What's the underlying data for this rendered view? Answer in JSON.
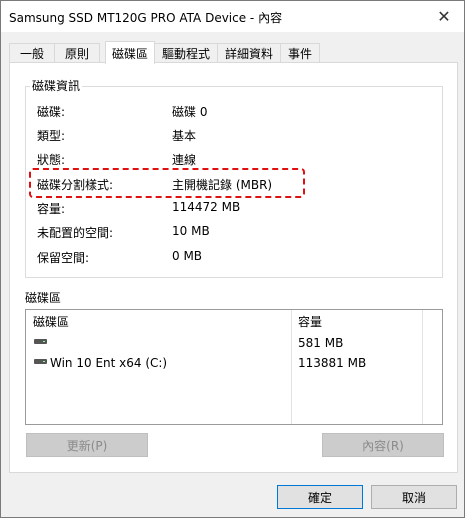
{
  "window": {
    "title": "Samsung SSD MT120G PRO ATA Device - 內容",
    "close_glyph": "✕"
  },
  "tabs": [
    {
      "label": "一般"
    },
    {
      "label": "原則"
    },
    {
      "label": "磁碟區"
    },
    {
      "label": "驅動程式"
    },
    {
      "label": "詳細資料"
    },
    {
      "label": "事件"
    }
  ],
  "active_tab": "磁碟區",
  "disk_info": {
    "group_label": "磁碟資訊",
    "rows": [
      {
        "label": "磁碟:",
        "value": "磁碟 0"
      },
      {
        "label": "類型:",
        "value": "基本"
      },
      {
        "label": "狀態:",
        "value": "連線"
      },
      {
        "label": "磁碟分割樣式:",
        "value": "主開機記錄 (MBR)"
      },
      {
        "label": "容量:",
        "value": "114472 MB"
      },
      {
        "label": "未配置的空間:",
        "value": "10 MB"
      },
      {
        "label": "保留空間:",
        "value": "0 MB"
      }
    ],
    "highlight_color": "#e01010"
  },
  "volumes": {
    "group_label": "磁碟區",
    "columns": [
      "磁碟區",
      "容量"
    ],
    "rows": [
      {
        "name": "",
        "capacity": "581 MB",
        "icon": "disk-icon"
      },
      {
        "name": "Win 10 Ent x64 (C:)",
        "capacity": "113881 MB",
        "icon": "disk-icon"
      }
    ]
  },
  "buttons": {
    "refresh": "更新(P)",
    "properties": "內容(R)",
    "ok": "確定",
    "cancel": "取消"
  }
}
